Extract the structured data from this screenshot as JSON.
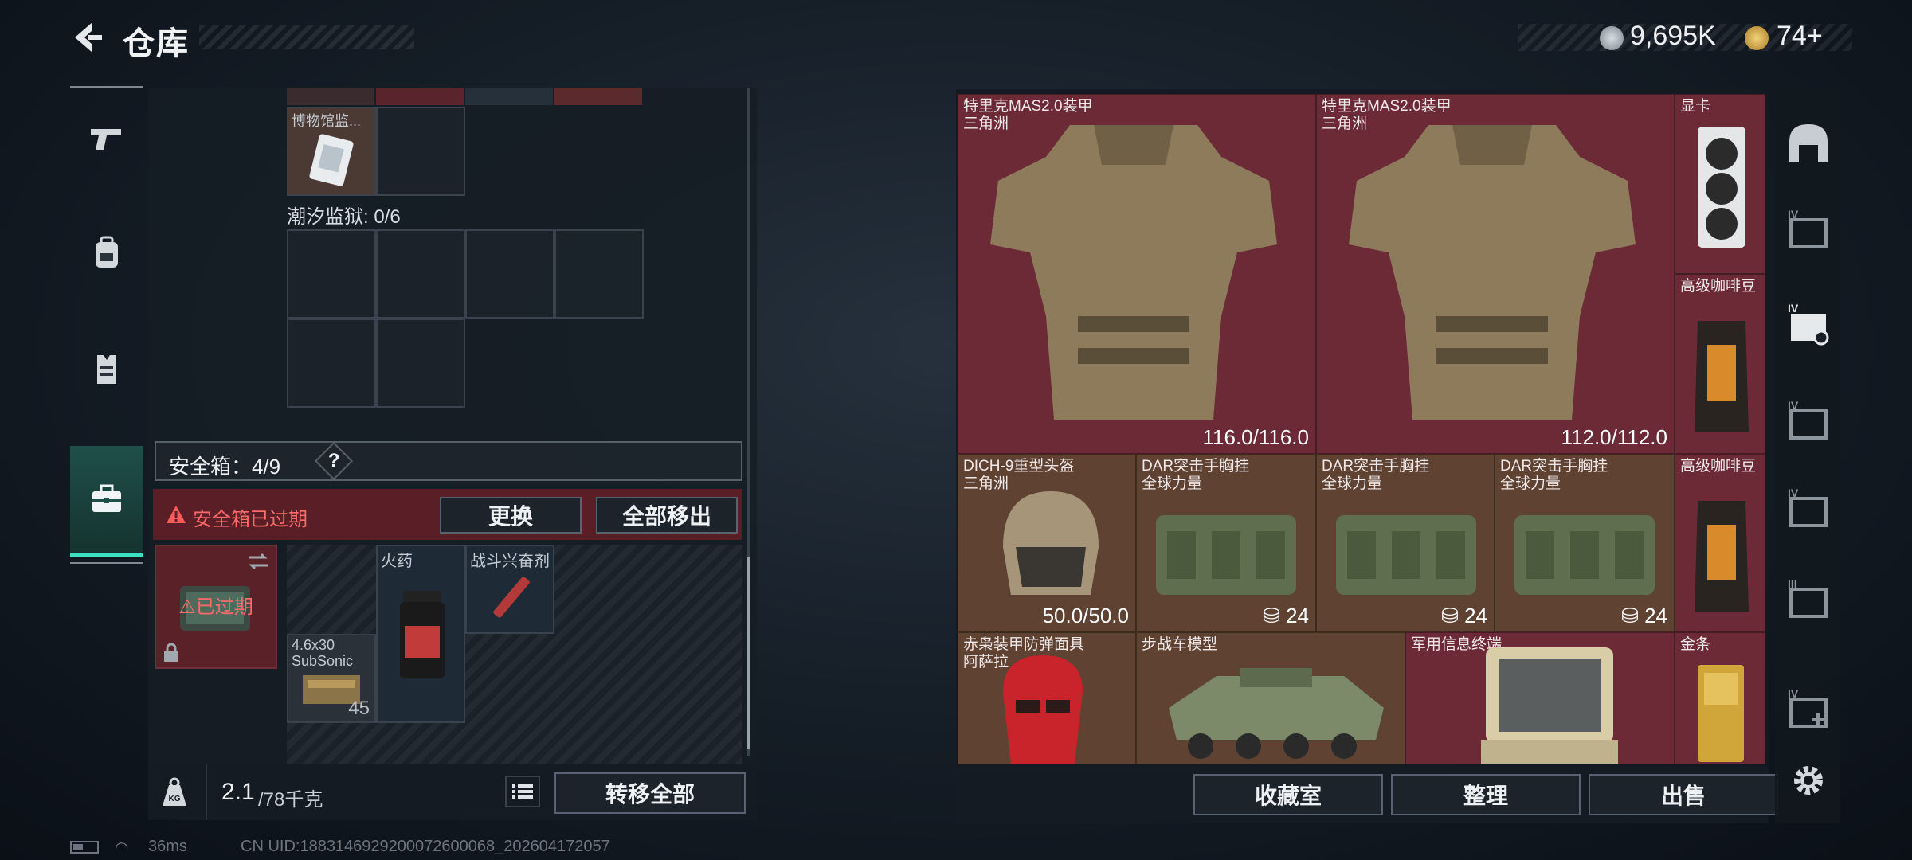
{
  "header": {
    "title": "仓库",
    "currency1_value": "9,695K",
    "currency2_value": "74+"
  },
  "tabs": [
    {
      "name": "weapons",
      "icon": "pistol-icon"
    },
    {
      "name": "equipment",
      "icon": "backpack-icon"
    },
    {
      "name": "armor",
      "icon": "vest-icon"
    },
    {
      "name": "safe-box",
      "icon": "toolbox-icon",
      "active": true
    }
  ],
  "left": {
    "museum_item_label": "博物馆监...",
    "prison_label": "潮汐监狱: 0/6",
    "safebox_label": "安全箱：4/9",
    "safebox_help": "?",
    "expired_warning": "安全箱已过期",
    "replace_button": "更换",
    "remove_all_button": "全部移出",
    "expired_badge": "已过期",
    "slot_gunpowder": "火药",
    "slot_stimulant": "战斗兴奋剂",
    "slot_ammo": "4.6x30 SubSonic",
    "ammo_count": "45",
    "weight_value": "2.1",
    "weight_max": "/78千克",
    "transfer_all_button": "转移全部",
    "kg_label": "KG"
  },
  "status": {
    "ping": "36ms",
    "uid": "CN UID:1883146929200072600068_202604172057"
  },
  "grid_items": [
    {
      "name": "特里克MAS2.0装甲",
      "sub": "三角洲",
      "value": "116.0/116.0",
      "color": "red"
    },
    {
      "name": "特里克MAS2.0装甲",
      "sub": "三角洲",
      "value": "112.0/112.0",
      "color": "red"
    },
    {
      "name": "显卡",
      "sub": "",
      "value": "",
      "color": "red"
    },
    {
      "name": "高级咖啡豆",
      "sub": "",
      "value": "",
      "color": "red"
    },
    {
      "name": "DICH-9重型头盔",
      "sub": "三角洲",
      "value": "50.0/50.0",
      "color": "brown"
    },
    {
      "name": "DAR突击手胸挂",
      "sub": "全球力量",
      "value": "24",
      "color": "brown"
    },
    {
      "name": "DAR突击手胸挂",
      "sub": "全球力量",
      "value": "24",
      "color": "brown"
    },
    {
      "name": "DAR突击手胸挂",
      "sub": "全球力量",
      "value": "24",
      "color": "brown"
    },
    {
      "name": "高级咖啡豆",
      "sub": "",
      "value": "",
      "color": "red"
    },
    {
      "name": "赤枭装甲防弹面具",
      "sub": "阿萨拉",
      "value": "",
      "color": "brown"
    },
    {
      "name": "步战车模型",
      "sub": "",
      "value": "",
      "color": "brown"
    },
    {
      "name": "军用信息终端",
      "sub": "",
      "value": "",
      "color": "red"
    },
    {
      "name": "金条",
      "sub": "",
      "value": "",
      "color": "red"
    }
  ],
  "right_buttons": {
    "collection": "收藏室",
    "sort": "整理",
    "sell": "出售"
  },
  "side_tier_labels": [
    "IV",
    "IV",
    "IV",
    "IV",
    "III",
    "IV"
  ]
}
